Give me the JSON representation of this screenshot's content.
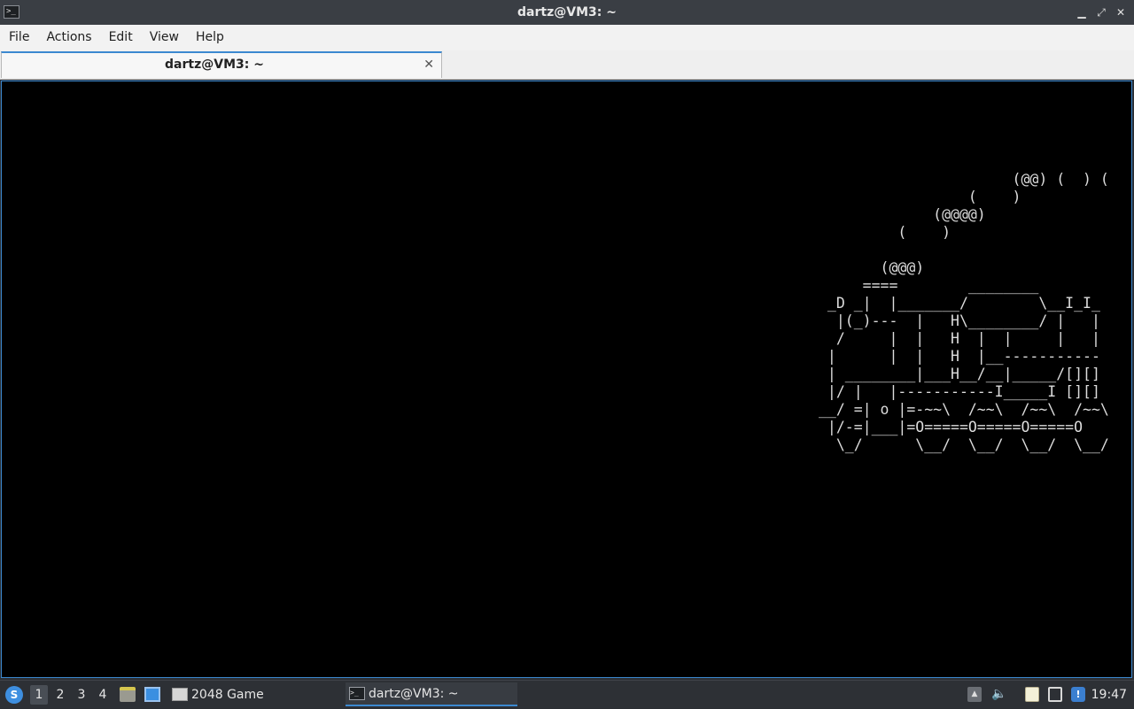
{
  "window": {
    "title": "dartz@VM3: ~",
    "controls": {
      "minimize": "▁",
      "maximize": "⤢",
      "close": "✕"
    }
  },
  "menu": [
    "File",
    "Actions",
    "Edit",
    "View",
    "Help"
  ],
  "tabs": [
    {
      "label": "dartz@VM3: ~",
      "close": "✕"
    }
  ],
  "terminal": {
    "ascii_art": "                      (@@) (  ) (\n                 (    )\n             (@@@@)\n         (    )\n\n       (@@@)\n     ====        ________\n _D _|  |_______/        \\__I_I_\n  |(_)---  |   H\\________/ |   |\n  /     |  |   H  |  |     |   |\n |      |  |   H  |__-----------\n | ________|___H__/__|_____/[][]\n |/ |   |-----------I_____I [][]\n__/ =| o |=-~~\\  /~~\\  /~~\\  /~~\\\n |/-=|___|=O=====O=====O=====O\n  \\_/      \\__/  \\__/  \\__/  \\__/",
    "colors": {
      "background": "#000000",
      "foreground": "#dcdcdc"
    }
  },
  "taskbar": {
    "desktops": [
      "1",
      "2",
      "3",
      "4"
    ],
    "active_desktop": "1",
    "tasks": [
      {
        "label": "2048 Game",
        "icon": "window-icon"
      },
      {
        "label": "dartz@VM3: ~",
        "icon": "terminal-icon",
        "active": true
      }
    ],
    "tray_icons": [
      "tray-arrow-icon",
      "volume-icon",
      "clipboard-icon",
      "network-icon",
      "update-icon"
    ],
    "clock": "19:47"
  },
  "accent_color": "#3c89d0"
}
